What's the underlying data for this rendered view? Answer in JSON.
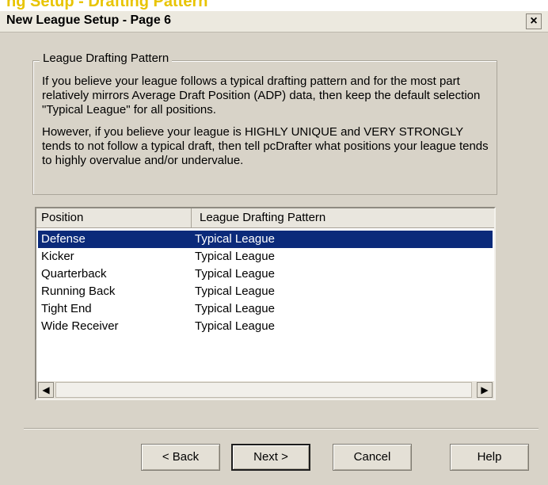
{
  "window": {
    "cropped_heading": "ng Setup - Drafting Pattern",
    "title": "New League Setup - Page 6",
    "close_label": "×"
  },
  "group": {
    "legend": "League Drafting Pattern",
    "paragraph1": "If you believe your league follows a typical drafting pattern and for the most part relatively mirrors Average Draft Position (ADP) data, then keep the default selection \"Typical League\" for all positions.",
    "paragraph2": "However, if you believe your league is HIGHLY UNIQUE and VERY STRONGLY tends to not follow a typical draft, then tell pcDrafter what positions your league tends to highly overvalue and/or undervalue."
  },
  "list": {
    "headers": {
      "position": "Position",
      "pattern": "League Drafting Pattern"
    },
    "rows": [
      {
        "position": "Defense",
        "pattern": "Typical League",
        "selected": true
      },
      {
        "position": "Kicker",
        "pattern": "Typical League"
      },
      {
        "position": "Quarterback",
        "pattern": "Typical League"
      },
      {
        "position": "Running Back",
        "pattern": "Typical League"
      },
      {
        "position": "Tight End",
        "pattern": "Typical League"
      },
      {
        "position": "Wide Receiver",
        "pattern": "Typical League"
      }
    ],
    "scroll_left": "◀",
    "scroll_right": "▶"
  },
  "buttons": {
    "back": "< Back",
    "next": "Next >",
    "cancel": "Cancel",
    "help": "Help"
  },
  "colors": {
    "dialog_bg": "#d8d3c8",
    "selection": "#0b2a7a"
  }
}
